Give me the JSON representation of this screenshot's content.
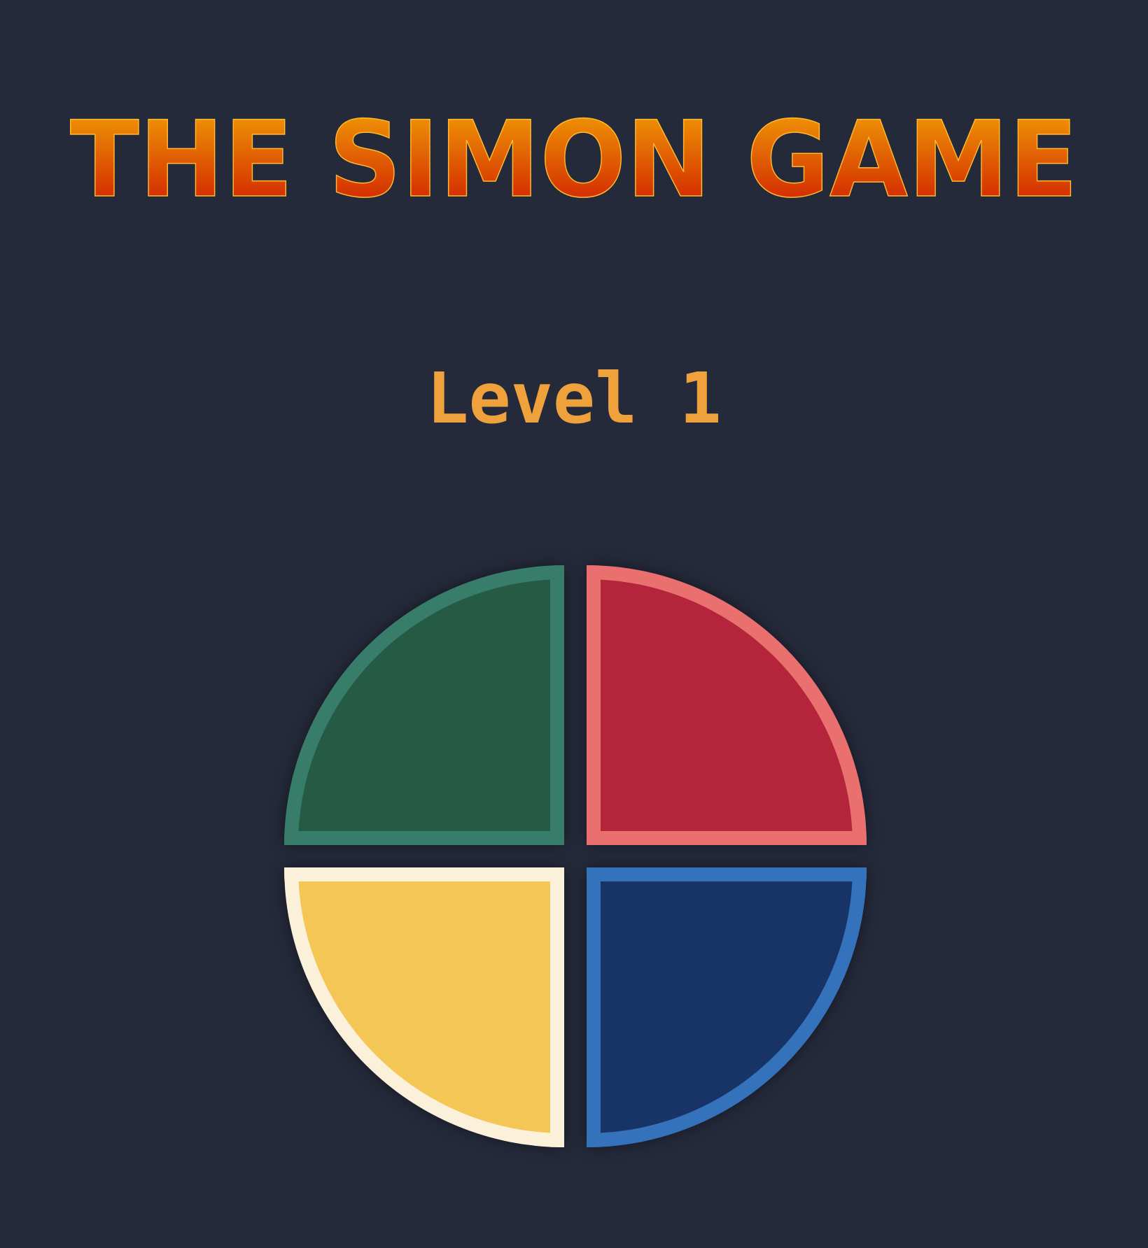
{
  "header": {
    "title": "THE SIMON GAME",
    "gradient_top": "#f4a506",
    "gradient_bottom": "#cc1200",
    "inline_color": "#ffba2e"
  },
  "status": {
    "level_text": "Level 1"
  },
  "pads": [
    {
      "id": "green",
      "fill": "#255b45",
      "border": "#377d6a"
    },
    {
      "id": "red",
      "fill": "#b4243b",
      "border": "#ea7070"
    },
    {
      "id": "yellow",
      "fill": "#f3c656",
      "border": "#fbf1db"
    },
    {
      "id": "blue",
      "fill": "#183366",
      "border": "#3473bc"
    }
  ],
  "colors": {
    "background": "#252a3b",
    "level_text": "#efa23c"
  }
}
